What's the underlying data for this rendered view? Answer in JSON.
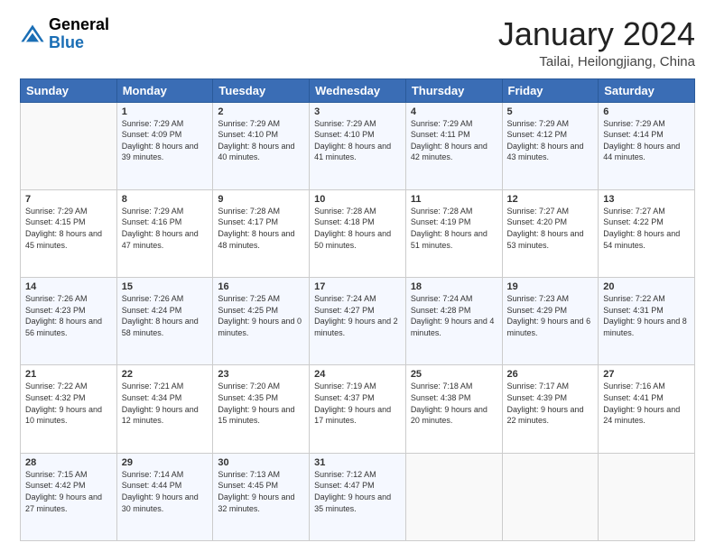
{
  "logo": {
    "line1": "General",
    "line2": "Blue"
  },
  "header": {
    "month": "January 2024",
    "location": "Tailai, Heilongjiang, China"
  },
  "weekdays": [
    "Sunday",
    "Monday",
    "Tuesday",
    "Wednesday",
    "Thursday",
    "Friday",
    "Saturday"
  ],
  "weeks": [
    [
      {
        "day": "",
        "sunrise": "",
        "sunset": "",
        "daylight": ""
      },
      {
        "day": "1",
        "sunrise": "Sunrise: 7:29 AM",
        "sunset": "Sunset: 4:09 PM",
        "daylight": "Daylight: 8 hours and 39 minutes."
      },
      {
        "day": "2",
        "sunrise": "Sunrise: 7:29 AM",
        "sunset": "Sunset: 4:10 PM",
        "daylight": "Daylight: 8 hours and 40 minutes."
      },
      {
        "day": "3",
        "sunrise": "Sunrise: 7:29 AM",
        "sunset": "Sunset: 4:10 PM",
        "daylight": "Daylight: 8 hours and 41 minutes."
      },
      {
        "day": "4",
        "sunrise": "Sunrise: 7:29 AM",
        "sunset": "Sunset: 4:11 PM",
        "daylight": "Daylight: 8 hours and 42 minutes."
      },
      {
        "day": "5",
        "sunrise": "Sunrise: 7:29 AM",
        "sunset": "Sunset: 4:12 PM",
        "daylight": "Daylight: 8 hours and 43 minutes."
      },
      {
        "day": "6",
        "sunrise": "Sunrise: 7:29 AM",
        "sunset": "Sunset: 4:14 PM",
        "daylight": "Daylight: 8 hours and 44 minutes."
      }
    ],
    [
      {
        "day": "7",
        "sunrise": "Sunrise: 7:29 AM",
        "sunset": "Sunset: 4:15 PM",
        "daylight": "Daylight: 8 hours and 45 minutes."
      },
      {
        "day": "8",
        "sunrise": "Sunrise: 7:29 AM",
        "sunset": "Sunset: 4:16 PM",
        "daylight": "Daylight: 8 hours and 47 minutes."
      },
      {
        "day": "9",
        "sunrise": "Sunrise: 7:28 AM",
        "sunset": "Sunset: 4:17 PM",
        "daylight": "Daylight: 8 hours and 48 minutes."
      },
      {
        "day": "10",
        "sunrise": "Sunrise: 7:28 AM",
        "sunset": "Sunset: 4:18 PM",
        "daylight": "Daylight: 8 hours and 50 minutes."
      },
      {
        "day": "11",
        "sunrise": "Sunrise: 7:28 AM",
        "sunset": "Sunset: 4:19 PM",
        "daylight": "Daylight: 8 hours and 51 minutes."
      },
      {
        "day": "12",
        "sunrise": "Sunrise: 7:27 AM",
        "sunset": "Sunset: 4:20 PM",
        "daylight": "Daylight: 8 hours and 53 minutes."
      },
      {
        "day": "13",
        "sunrise": "Sunrise: 7:27 AM",
        "sunset": "Sunset: 4:22 PM",
        "daylight": "Daylight: 8 hours and 54 minutes."
      }
    ],
    [
      {
        "day": "14",
        "sunrise": "Sunrise: 7:26 AM",
        "sunset": "Sunset: 4:23 PM",
        "daylight": "Daylight: 8 hours and 56 minutes."
      },
      {
        "day": "15",
        "sunrise": "Sunrise: 7:26 AM",
        "sunset": "Sunset: 4:24 PM",
        "daylight": "Daylight: 8 hours and 58 minutes."
      },
      {
        "day": "16",
        "sunrise": "Sunrise: 7:25 AM",
        "sunset": "Sunset: 4:25 PM",
        "daylight": "Daylight: 9 hours and 0 minutes."
      },
      {
        "day": "17",
        "sunrise": "Sunrise: 7:24 AM",
        "sunset": "Sunset: 4:27 PM",
        "daylight": "Daylight: 9 hours and 2 minutes."
      },
      {
        "day": "18",
        "sunrise": "Sunrise: 7:24 AM",
        "sunset": "Sunset: 4:28 PM",
        "daylight": "Daylight: 9 hours and 4 minutes."
      },
      {
        "day": "19",
        "sunrise": "Sunrise: 7:23 AM",
        "sunset": "Sunset: 4:29 PM",
        "daylight": "Daylight: 9 hours and 6 minutes."
      },
      {
        "day": "20",
        "sunrise": "Sunrise: 7:22 AM",
        "sunset": "Sunset: 4:31 PM",
        "daylight": "Daylight: 9 hours and 8 minutes."
      }
    ],
    [
      {
        "day": "21",
        "sunrise": "Sunrise: 7:22 AM",
        "sunset": "Sunset: 4:32 PM",
        "daylight": "Daylight: 9 hours and 10 minutes."
      },
      {
        "day": "22",
        "sunrise": "Sunrise: 7:21 AM",
        "sunset": "Sunset: 4:34 PM",
        "daylight": "Daylight: 9 hours and 12 minutes."
      },
      {
        "day": "23",
        "sunrise": "Sunrise: 7:20 AM",
        "sunset": "Sunset: 4:35 PM",
        "daylight": "Daylight: 9 hours and 15 minutes."
      },
      {
        "day": "24",
        "sunrise": "Sunrise: 7:19 AM",
        "sunset": "Sunset: 4:37 PM",
        "daylight": "Daylight: 9 hours and 17 minutes."
      },
      {
        "day": "25",
        "sunrise": "Sunrise: 7:18 AM",
        "sunset": "Sunset: 4:38 PM",
        "daylight": "Daylight: 9 hours and 20 minutes."
      },
      {
        "day": "26",
        "sunrise": "Sunrise: 7:17 AM",
        "sunset": "Sunset: 4:39 PM",
        "daylight": "Daylight: 9 hours and 22 minutes."
      },
      {
        "day": "27",
        "sunrise": "Sunrise: 7:16 AM",
        "sunset": "Sunset: 4:41 PM",
        "daylight": "Daylight: 9 hours and 24 minutes."
      }
    ],
    [
      {
        "day": "28",
        "sunrise": "Sunrise: 7:15 AM",
        "sunset": "Sunset: 4:42 PM",
        "daylight": "Daylight: 9 hours and 27 minutes."
      },
      {
        "day": "29",
        "sunrise": "Sunrise: 7:14 AM",
        "sunset": "Sunset: 4:44 PM",
        "daylight": "Daylight: 9 hours and 30 minutes."
      },
      {
        "day": "30",
        "sunrise": "Sunrise: 7:13 AM",
        "sunset": "Sunset: 4:45 PM",
        "daylight": "Daylight: 9 hours and 32 minutes."
      },
      {
        "day": "31",
        "sunrise": "Sunrise: 7:12 AM",
        "sunset": "Sunset: 4:47 PM",
        "daylight": "Daylight: 9 hours and 35 minutes."
      },
      {
        "day": "",
        "sunrise": "",
        "sunset": "",
        "daylight": ""
      },
      {
        "day": "",
        "sunrise": "",
        "sunset": "",
        "daylight": ""
      },
      {
        "day": "",
        "sunrise": "",
        "sunset": "",
        "daylight": ""
      }
    ]
  ]
}
